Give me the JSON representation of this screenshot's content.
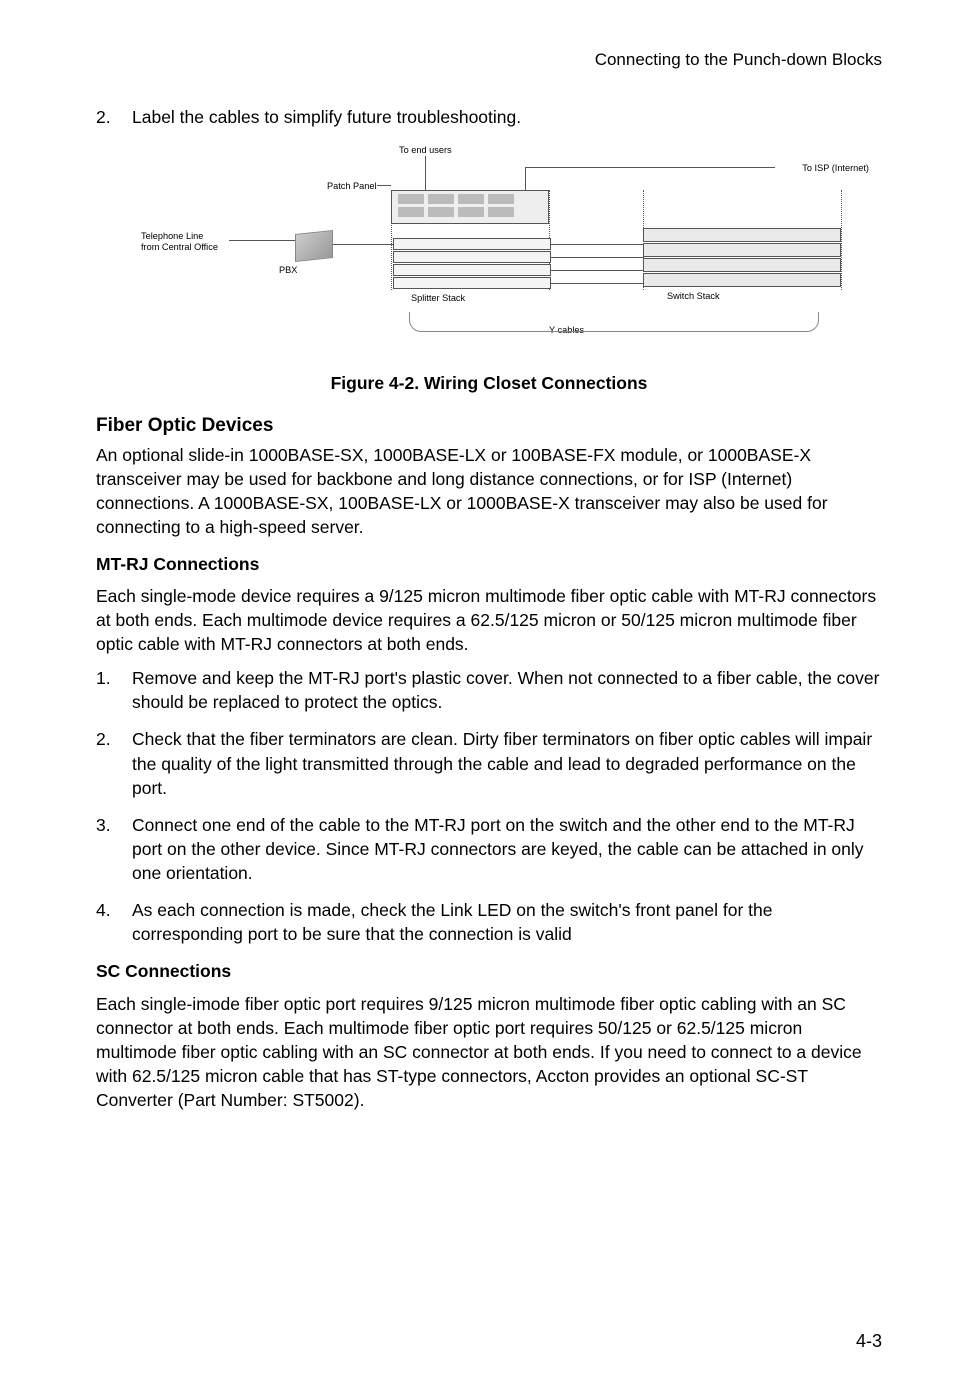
{
  "header": "Connecting to the Punch-down Blocks",
  "step2": {
    "num": "2.",
    "text": "Label the cables to simplify future troubleshooting."
  },
  "diagram": {
    "to_end_users": "To end users",
    "to_isp": "To ISP (Internet)",
    "patch_panel": "Patch Panel",
    "telephone_line": "Telephone Line",
    "from_co": "from Central Office",
    "pbx": "PBX",
    "splitter_stack": "Splitter Stack",
    "switch_stack": "Switch Stack",
    "y_cables": "Y cables"
  },
  "fig_caption": "Figure 4-2.  Wiring Closet Connections",
  "fiber_heading": "Fiber Optic Devices",
  "fiber_para": "An optional slide-in 1000BASE-SX, 1000BASE-LX or 100BASE-FX module, or 1000BASE-X transceiver may be used for backbone and long distance connections, or for ISP (Internet) connections. A 1000BASE-SX, 100BASE-LX or 1000BASE-X transceiver may also be used for connecting to a high-speed server.",
  "mtrj_heading": "MT-RJ Connections",
  "mtrj_para": "Each single-mode device requires a 9/125 micron multimode fiber optic cable with MT-RJ connectors at both ends. Each multimode device requires a 62.5/125 micron or 50/125 micron multimode fiber optic cable with MT-RJ connectors at both ends.",
  "mtrj_steps": [
    {
      "n": "1.",
      "t": "Remove and keep the MT-RJ port's plastic cover. When not connected to a fiber cable, the cover should be replaced to protect the optics."
    },
    {
      "n": "2.",
      "t": "Check that the fiber terminators are clean. Dirty fiber terminators on fiber optic cables will impair the quality of the light transmitted through the cable and lead to degraded performance on the port."
    },
    {
      "n": "3.",
      "t": "Connect one end of the cable to the MT-RJ port on the switch and the other end to the MT-RJ port on the other device. Since MT-RJ connectors are keyed, the cable can be attached in only one orientation."
    },
    {
      "n": "4.",
      "t": "As each connection is made, check the Link LED on the switch's front panel for the corresponding port to be sure that the connection is valid"
    }
  ],
  "sc_heading": "SC Connections",
  "sc_para": "Each single-imode fiber optic port requires 9/125 micron multimode fiber optic cabling with an SC connector at both ends. Each multimode fiber optic port requires 50/125 or 62.5/125 micron multimode fiber optic cabling with an SC connector at both ends. If you need to connect to a device with 62.5/125 micron cable that has ST-type connectors, Accton provides an optional SC-ST Converter (Part Number: ST5002).",
  "page_num": "4-3"
}
